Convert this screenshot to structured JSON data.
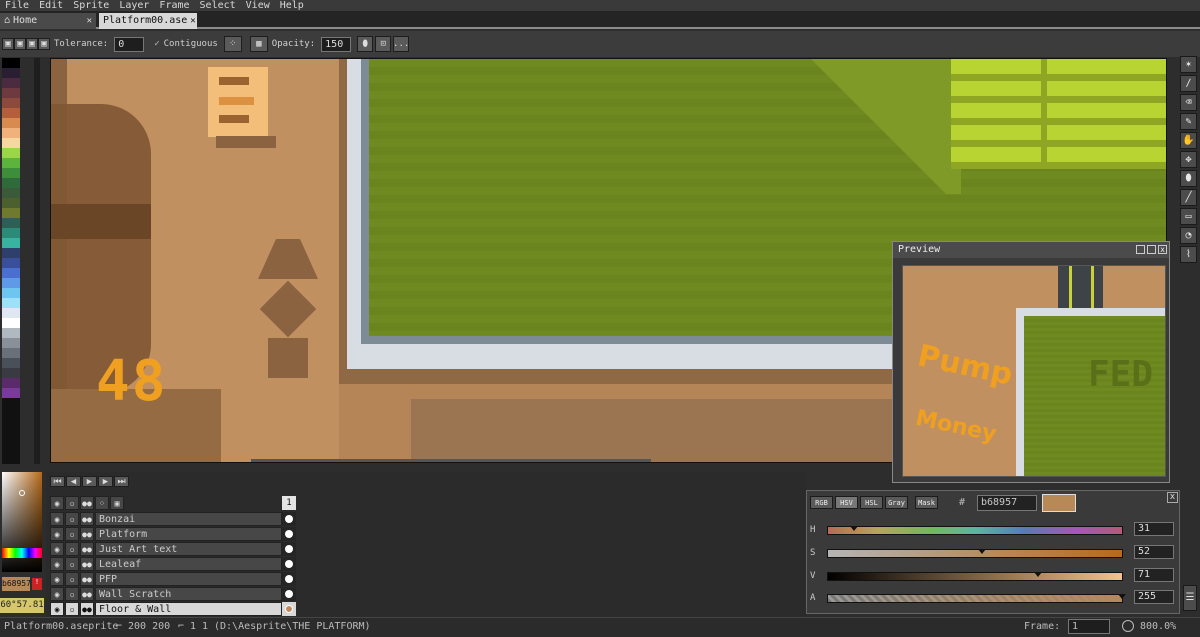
{
  "menu": [
    "File",
    "Edit",
    "Sprite",
    "Layer",
    "Frame",
    "Select",
    "View",
    "Help"
  ],
  "tabs": {
    "home": "Home",
    "file": "Platform00.ase",
    "close": "✕"
  },
  "context_bar": {
    "tolerance_label": "Tolerance:",
    "tolerance_value": "0",
    "contiguous_label": "Contiguous",
    "opacity_label": "Opacity:",
    "opacity_value": "150",
    "more": "..."
  },
  "palette_colors": [
    "#000000",
    "#2a1e33",
    "#4b2b3f",
    "#6f3a3f",
    "#8b4a3b",
    "#b55e3b",
    "#d88a4f",
    "#f0b27a",
    "#f5d7a0",
    "#9bd648",
    "#5cb43c",
    "#3d8d3a",
    "#2e6a3a",
    "#3a5a3a",
    "#4c5f2e",
    "#6f7a2e",
    "#2e5f55",
    "#2b8a78",
    "#38b3a0",
    "#2d3f6a",
    "#3a4f9a",
    "#4a6fd0",
    "#5f9ae8",
    "#6ec6f0",
    "#9de0f8",
    "#dfe8f2",
    "#ffffff",
    "#b0b8c0",
    "#8a909a",
    "#6a707a",
    "#4a505a",
    "#3a3a42",
    "#5a2a6a",
    "#7a3a9a"
  ],
  "color_box": {
    "hex": "b68957",
    "coords": "60°57.81"
  },
  "canvas": {
    "label_48": "48"
  },
  "tools": [
    "✶",
    "∕",
    "⌫",
    "✎",
    "✋",
    "✥",
    "⬮",
    "╱",
    "▭",
    "◔",
    "⌇"
  ],
  "preview": {
    "title": "Preview",
    "text_pump": "Pump",
    "text_money": "Money",
    "text_fed": "FED"
  },
  "timeline": {
    "frame_header": "1",
    "layers": [
      {
        "name": "Bonzai"
      },
      {
        "name": "Platform"
      },
      {
        "name": "Just Art text"
      },
      {
        "name": "Lealeaf"
      },
      {
        "name": "PFP"
      },
      {
        "name": "Wall Scratch"
      },
      {
        "name": "Floor & Wall"
      }
    ]
  },
  "color_panel": {
    "tabs": [
      "RGB",
      "HSV",
      "HSL",
      "Gray",
      "Mask"
    ],
    "selected_tab": "HSV",
    "hash": "#",
    "hex": "b68957",
    "swatch_color": "#b68957",
    "sliders": [
      {
        "label": "H",
        "value": "31"
      },
      {
        "label": "S",
        "value": "52"
      },
      {
        "label": "V",
        "value": "71"
      },
      {
        "label": "A",
        "value": "255"
      }
    ]
  },
  "status": {
    "file": "Platform00.aseprite",
    "size": "200 200",
    "scale": "1 1",
    "path": "(D:\\Aesprite\\THE PLATFORM)",
    "frame_label": "Frame:",
    "frame_value": "1",
    "zoom": "800.0%"
  }
}
